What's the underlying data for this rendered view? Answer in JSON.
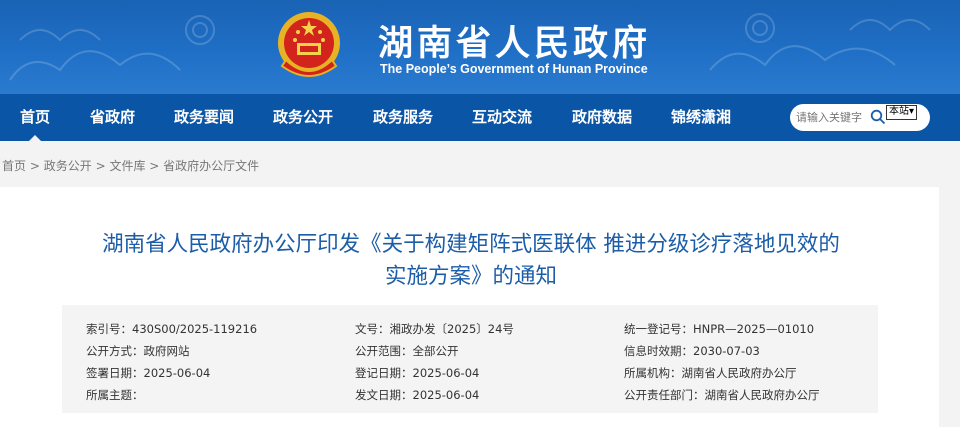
{
  "header": {
    "title": "湖南省人民政府",
    "subtitle": "The People’s Government of Hunan Province"
  },
  "nav": {
    "items": [
      {
        "label": "首页",
        "active": true
      },
      {
        "label": "省政府"
      },
      {
        "label": "政务要闻"
      },
      {
        "label": "政务公开"
      },
      {
        "label": "政务服务"
      },
      {
        "label": "互动交流"
      },
      {
        "label": "政府数据"
      },
      {
        "label": "锦绣潇湘"
      }
    ],
    "search": {
      "placeholder": "请输入关键字",
      "scope": "本站"
    }
  },
  "breadcrumb": [
    "首页",
    "政务公开",
    "文件库",
    "省政府办公厅文件"
  ],
  "document": {
    "title_line1": "湖南省人民政府办公厅印发《关于构建矩阵式医联体 推进分级诊疗落地见效的",
    "title_line2": "实施方案》的通知",
    "meta": {
      "index_no": "索引号：430S00/2025-119216",
      "doc_no": "文号：湘政办发〔2025〕24号",
      "unified_no": "统一登记号：HNPR—2025—01010",
      "publish_method": "公开方式：政府网站",
      "publish_scope": "公开范围：全部公开",
      "valid_until": "信息时效期：2030-07-03",
      "sign_date": "签署日期：2025-06-04",
      "register_date": "登记日期：2025-06-04",
      "org": "所属机构：湖南省人民政府办公厅",
      "topic": "所属主题：",
      "issue_date": "发文日期：2025-06-04",
      "responsible_dept": "公开责任部门：湖南省人民政府办公厅"
    }
  },
  "colors": {
    "banner": "#1f6fc6",
    "nav": "#0b55a6",
    "title": "#1c5da8"
  }
}
